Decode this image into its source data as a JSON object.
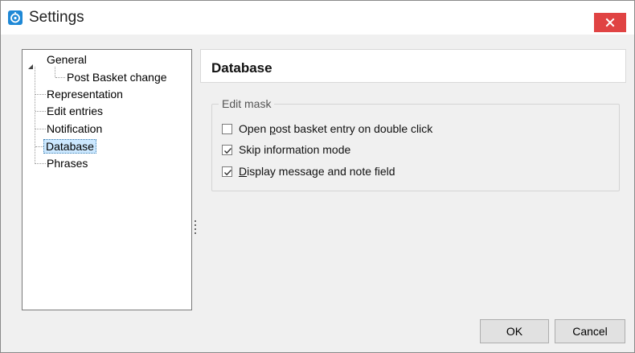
{
  "window": {
    "title": "Settings",
    "close_icon": "close-icon",
    "app_icon": "app-logo-icon",
    "close_color": "#e04343"
  },
  "tree": {
    "items": [
      {
        "label": "General",
        "expanded": true
      },
      {
        "label": "Post Basket change",
        "child_of": "General"
      },
      {
        "label": "Representation"
      },
      {
        "label": "Edit entries"
      },
      {
        "label": "Notification"
      },
      {
        "label": "Database",
        "selected": true
      },
      {
        "label": "Phrases"
      }
    ]
  },
  "content": {
    "title": "Database",
    "group": {
      "label": "Edit mask",
      "options": [
        {
          "pre": "Open ",
          "mnemonic": "p",
          "post": "ost basket entry on double click",
          "checked": false
        },
        {
          "pre": "Skip information mode",
          "mnemonic": "",
          "post": "",
          "checked": true
        },
        {
          "pre": "",
          "mnemonic": "D",
          "post": "isplay message and note field",
          "checked": true
        }
      ]
    }
  },
  "buttons": {
    "ok_label": "OK",
    "cancel_label": "Cancel"
  },
  "colors": {
    "selection_bg": "#cce8ff",
    "selection_border": "#3c7fb1",
    "accent": "#1e88d6"
  }
}
